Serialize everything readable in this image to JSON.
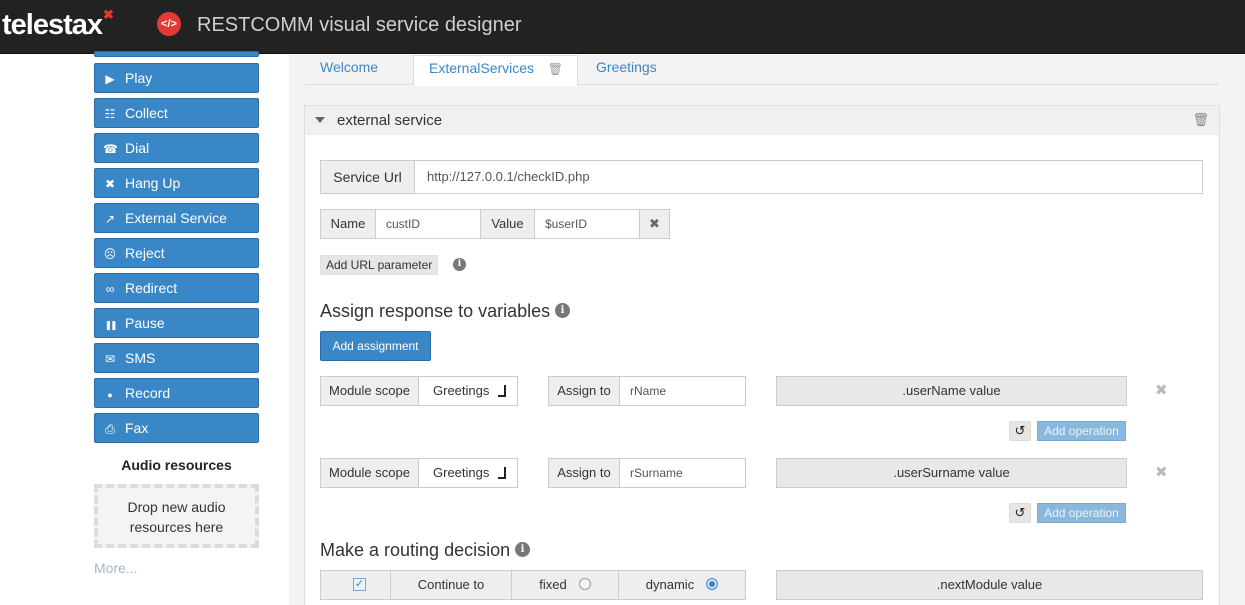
{
  "header": {
    "logo_text": "telestax",
    "logo_mark": "✖",
    "app_icon": "</>",
    "title": "RESTCOMM visual service designer"
  },
  "sidebar": {
    "items": [
      {
        "label": "Play",
        "icon": "play-icon",
        "glyph": "▶"
      },
      {
        "label": "Collect",
        "icon": "grid-icon",
        "glyph": "☷"
      },
      {
        "label": "Dial",
        "icon": "phone-icon",
        "glyph": "☎"
      },
      {
        "label": "Hang Up",
        "icon": "close-icon",
        "glyph": "✖"
      },
      {
        "label": "External Service",
        "icon": "external-link-icon",
        "glyph": "↗"
      },
      {
        "label": "Reject",
        "icon": "thumbs-down-icon",
        "glyph": "☹"
      },
      {
        "label": "Redirect",
        "icon": "link-icon",
        "glyph": "∞"
      },
      {
        "label": "Pause",
        "icon": "pause-icon",
        "glyph": "❚❚"
      },
      {
        "label": "SMS",
        "icon": "envelope-icon",
        "glyph": "✉"
      },
      {
        "label": "Record",
        "icon": "microphone-icon",
        "glyph": "●"
      },
      {
        "label": "Fax",
        "icon": "print-icon",
        "glyph": "⎙"
      }
    ],
    "audio_title": "Audio resources",
    "dropzone_line1": "Drop new audio",
    "dropzone_line2": "resources here",
    "more_link": "More..."
  },
  "tabs": [
    {
      "label": "Welcome",
      "active": false
    },
    {
      "label": "ExternalServices",
      "active": true
    },
    {
      "label": "Greetings",
      "active": false
    }
  ],
  "module": {
    "title": "external service",
    "service_url_label": "Service Url",
    "service_url": "http://127.0.0.1/checkID.php",
    "param": {
      "name_label": "Name",
      "name": "custID",
      "value_label": "Value",
      "value": "$userID"
    },
    "add_param_label": "Add URL parameter",
    "assign_title": "Assign response to variables",
    "add_assignment_label": "Add assignment",
    "assignments": [
      {
        "scope_label": "Module scope",
        "scope": "Greetings",
        "assign_label": "Assign to",
        "variable": "rName",
        "value": ".userName value",
        "add_op": "Add operation"
      },
      {
        "scope_label": "Module scope",
        "scope": "Greetings",
        "assign_label": "Assign to",
        "variable": "rSurname",
        "value": ".userSurname value",
        "add_op": "Add operation"
      }
    ],
    "routing_title": "Make a routing decision",
    "routing": {
      "continue_label": "Continue to",
      "fixed_label": "fixed",
      "dynamic_label": "dynamic",
      "selected": "dynamic",
      "value": ".nextModule value"
    }
  },
  "colors": {
    "accent": "#3a87c8",
    "topbar": "#222222",
    "brand_red": "#e53935"
  }
}
